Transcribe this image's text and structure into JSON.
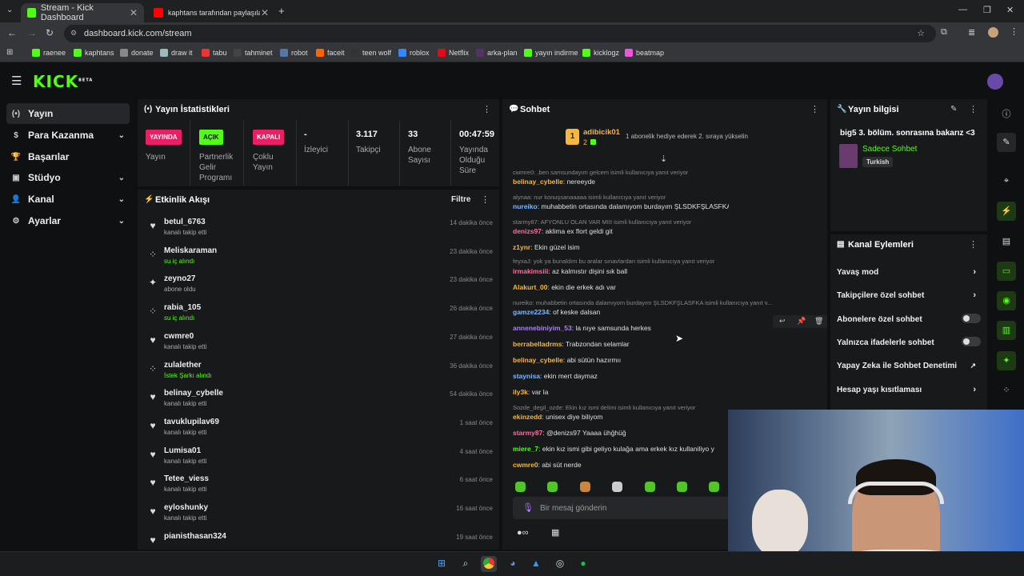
{
  "browser": {
    "tabs": [
      {
        "title": "Stream - Kick Dashboard",
        "close": "✕"
      },
      {
        "title": "kaphtans tarafından paylaşılan",
        "close": "✕"
      }
    ],
    "new_tab": "+",
    "url": "dashboard.kick.com/stream",
    "bookmarks": [
      "raenee",
      "kaphtans",
      "donate",
      "draw it",
      "tabu",
      "tahminet",
      "robot",
      "faceit",
      "teen wolf",
      "roblox",
      "Netflix",
      "arka-plan",
      "yayın indirme",
      "kicklogz",
      "beatmap"
    ]
  },
  "app": {
    "logo": "KICK",
    "logo_sup": "BETA"
  },
  "sidenav": [
    {
      "label": "Yayın",
      "icon": "(•)"
    },
    {
      "label": "Para Kazanma",
      "icon": "$",
      "chev": "⌄"
    },
    {
      "label": "Başarılar",
      "icon": "🏆"
    },
    {
      "label": "Stüdyo",
      "icon": "▣",
      "chev": "⌄"
    },
    {
      "label": "Kanal",
      "icon": "👤",
      "chev": "⌄"
    },
    {
      "label": "Ayarlar",
      "icon": "⚙",
      "chev": "⌄"
    }
  ],
  "stats": {
    "title": "Yayın İstatistikleri",
    "cells": [
      {
        "badge": "YAYINDA",
        "badge_color": "#e91e63",
        "label": "Yayın"
      },
      {
        "badge": "AÇIK",
        "badge_color": "#53fc18",
        "label": "Partnerlik Gelir Programı"
      },
      {
        "badge": "KAPALI",
        "badge_color": "#e91e63",
        "label": "Çoklu Yayın"
      },
      {
        "value": "-",
        "label": "İzleyici"
      },
      {
        "value": "3.117",
        "label": "Takipçi"
      },
      {
        "value": "33",
        "label": "Abone Sayısı"
      },
      {
        "value": "00:47:59",
        "label": "Yayında Olduğu Süre"
      }
    ]
  },
  "activity": {
    "title": "Etkinlik Akışı",
    "filter": "Filtre",
    "items": [
      {
        "name": "betul_6763",
        "action": "kanalı takip etti",
        "time": "14 dakika önce",
        "icon": "♥",
        "green": false
      },
      {
        "name": "Meliskaraman",
        "action": "su iç alındı",
        "time": "23 dakika önce",
        "icon": "⁘",
        "green": true
      },
      {
        "name": "zeyno27",
        "action": "abone oldu",
        "time": "23 dakika önce",
        "icon": "✦",
        "green": false
      },
      {
        "name": "rabia_105",
        "action": "su iç alındı",
        "time": "26 dakika önce",
        "icon": "⁘",
        "green": true
      },
      {
        "name": "cwmre0",
        "action": "kanalı takip etti",
        "time": "27 dakika önce",
        "icon": "♥",
        "green": false
      },
      {
        "name": "zulalether",
        "action": "İstek Şarkı alındı",
        "time": "36 dakika önce",
        "icon": "⁘",
        "green": true
      },
      {
        "name": "belinay_cybelle",
        "action": "kanalı takip etti",
        "time": "54 dakika önce",
        "icon": "♥",
        "green": false
      },
      {
        "name": "tavuklupilav69",
        "action": "kanalı takip etti",
        "time": "1 saat önce",
        "icon": "♥",
        "green": false
      },
      {
        "name": "Lumisa01",
        "action": "kanalı takip etti",
        "time": "4 saat önce",
        "icon": "♥",
        "green": false
      },
      {
        "name": "Tetee_viess",
        "action": "kanalı takip etti",
        "time": "6 saat önce",
        "icon": "♥",
        "green": false
      },
      {
        "name": "eyloshunky",
        "action": "kanalı takip etti",
        "time": "16 saat önce",
        "icon": "♥",
        "green": false
      },
      {
        "name": "pianisthasan324",
        "action": "",
        "time": "19 saat önce",
        "icon": "♥",
        "green": false
      }
    ]
  },
  "chat": {
    "title": "Sohbet",
    "pinned_user": "adibicik01",
    "pinned_count": "2",
    "pinned_rank": "1",
    "pinned_text": "1 abonelik hediye ederek 2. sıraya yükselin",
    "placeholder": "Bir mesaj gönderin",
    "lines": [
      {
        "type": "reply",
        "text": "cwmre0: ,ben samsundayım gelcem isimli kullanıcıya yanıt veriyor"
      },
      {
        "user": "belinay_cybelle",
        "color": "#f6b73c",
        "msg": "nereeyde"
      },
      {
        "type": "reply",
        "text": "alynaa: nur konuşsanaaaaa isimli kullanıcıya yanıt veriyor"
      },
      {
        "user": "nureiko",
        "color": "#7cb9ff",
        "msg": "muhabbetin ortasında dalamıyom burdayım ŞLSDKFŞLASFKA"
      },
      {
        "type": "reply",
        "text": "starmy87: AFYONLU OLAN VAR MIII isimli kullanıcıya yanıt veriyor"
      },
      {
        "user": "denizs97",
        "color": "#ff6b9e",
        "msg": "aklima ex flort geldi git"
      },
      {
        "user": "z1ynr",
        "color": "#f6b73c",
        "msg": "Ekin güzel isim"
      },
      {
        "type": "reply",
        "text": "feyxaJ: yok ya bunaldım bu aralar sınavlardan isimli kullanıcıya yanıt veriyor"
      },
      {
        "user": "irmakimsiii",
        "color": "#ff6b9e",
        "msg": "az kalmıstır dişini sık ball"
      },
      {
        "user": "Alakurt_00",
        "color": "#f6b73c",
        "msg": "ekin die erkek adı var"
      },
      {
        "type": "reply",
        "text": "nureiko: muhabbetin ortasında dalamıyom burdayım ŞLSDKFŞLASFKA isimli kullanıcıya yanıt v..."
      },
      {
        "user": "gamze2234",
        "color": "#7cb9ff",
        "msg": "of keske dalsan"
      },
      {
        "user": "annenebiniyim_53",
        "color": "#b07cff",
        "msg": "la nıye samsunda herkes"
      },
      {
        "user": "berrabelladrms",
        "color": "#f6b73c",
        "msg": "Trabzondan selamlar"
      },
      {
        "user": "belinay_cybelle",
        "color": "#f6b73c",
        "msg": "abi sütün hazırmıı"
      },
      {
        "user": "staynisa",
        "color": "#7cb9ff",
        "msg": "ekin mert daymaz"
      },
      {
        "user": "ily3k",
        "color": "#f6b73c",
        "msg": "var la"
      },
      {
        "type": "reply",
        "text": "Sozde_degil_ozde: Ekin kız ismi delimi isimli kullanıcıya yanıt veriyor"
      },
      {
        "user": "ekinzedd",
        "color": "#f6b73c",
        "msg": "unisex diye biliyom"
      },
      {
        "user": "starmy87",
        "color": "#ff6b9e",
        "msg": "@denizs97 Yaaaa ühğhüğ"
      },
      {
        "user": "miere_7",
        "color": "#53fc18",
        "msg": "ekin kız ismi gibi geliyo kulağa ama erkek kız kullaniliyo y"
      },
      {
        "user": "cwmre0",
        "color": "#f6b73c",
        "msg": "abi süt nerde"
      }
    ]
  },
  "stream_info": {
    "title": "Yayın bilgisi",
    "stream_title": "big5 3. bölüm. sonrasına bakarız <3",
    "category": "Sadece Sohbet",
    "language": "Turkish"
  },
  "channel_actions": {
    "title": "Kanal Eylemleri",
    "items": [
      {
        "label": "Yavaş mod",
        "kind": "chev"
      },
      {
        "label": "Takipçilere özel sohbet",
        "kind": "chev"
      },
      {
        "label": "Abonelere özel sohbet",
        "kind": "toggle"
      },
      {
        "label": "Yalnızca ifadelerle sohbet",
        "kind": "toggle"
      },
      {
        "label": "Yapay Zeka ile Sohbet Denetimi",
        "kind": "link"
      },
      {
        "label": "Hesap yaşı kısıtlaması",
        "kind": "chev"
      }
    ]
  }
}
